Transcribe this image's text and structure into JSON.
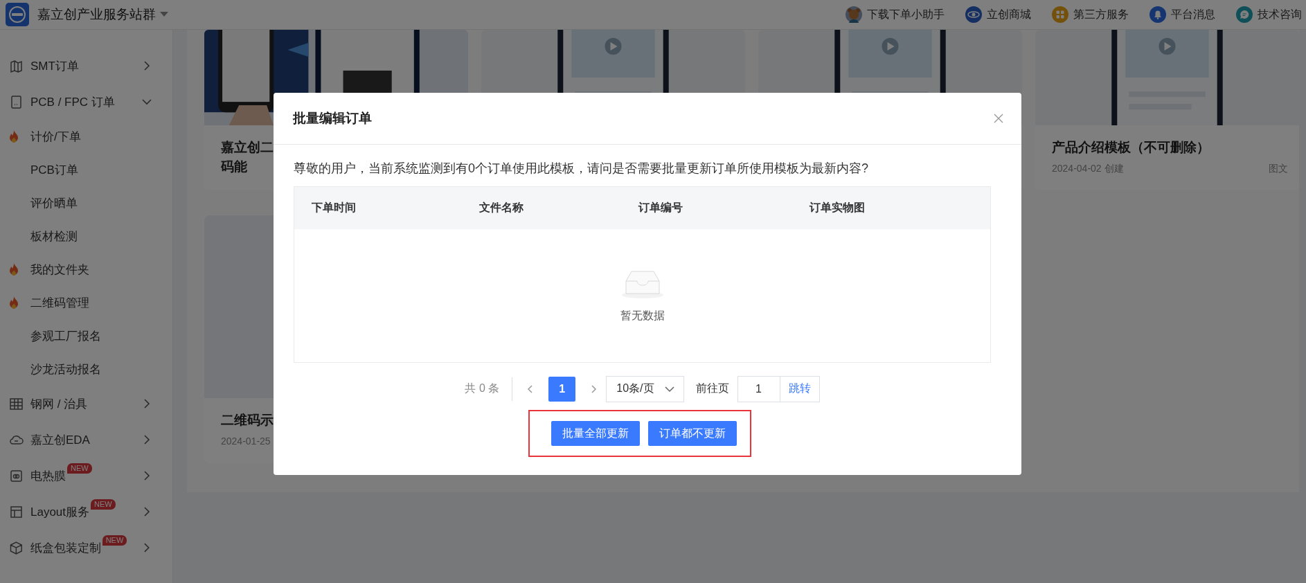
{
  "header": {
    "title": "嘉立创产业服务站群",
    "links": [
      {
        "label": "下载下单小助手",
        "kind": "bear"
      },
      {
        "label": "立创商城",
        "kind": "store"
      },
      {
        "label": "第三方服务",
        "kind": "apps"
      },
      {
        "label": "平台消息",
        "kind": "bell"
      },
      {
        "label": "技术咨询",
        "kind": "chat"
      }
    ]
  },
  "sidebar": {
    "items": [
      {
        "label": "SMT订单",
        "kind": "map",
        "expanded": false
      },
      {
        "label": "PCB / FPC 订单",
        "kind": "board",
        "expanded": true,
        "children": [
          {
            "label": "计价/下单",
            "hot": true
          },
          {
            "label": "PCB订单",
            "hot": false
          },
          {
            "label": "评价晒单",
            "hot": false
          },
          {
            "label": "板材检测",
            "hot": false
          },
          {
            "label": "我的文件夹",
            "hot": true
          },
          {
            "label": "二维码管理",
            "hot": true
          },
          {
            "label": "参观工厂报名",
            "hot": false
          },
          {
            "label": "沙龙活动报名",
            "hot": false
          }
        ]
      },
      {
        "label": "钢网 / 治具",
        "kind": "grid",
        "expanded": false
      },
      {
        "label": "嘉立创EDA",
        "kind": "cloud",
        "expanded": false
      },
      {
        "label": "电热膜",
        "kind": "film",
        "expanded": false,
        "badge": "NEW"
      },
      {
        "label": "Layout服务",
        "kind": "layout",
        "expanded": false,
        "badge": "NEW"
      },
      {
        "label": "纸盒包装定制",
        "kind": "box",
        "expanded": false,
        "badge": "NEW"
      }
    ]
  },
  "cards": [
    [
      {
        "kind": "picture",
        "title": [
          "嘉立创二",
          "码能"
        ]
      },
      {
        "kind": "picture"
      },
      {
        "kind": "picture"
      },
      {
        "kind": "picture",
        "title": [
          "产品介绍模板（不可删除）"
        ],
        "date": "2024-04-02 创建",
        "type": "图文"
      }
    ],
    [
      {
        "kind": "picture",
        "title": [
          "二维码示"
        ],
        "date": "2024-01-25"
      }
    ]
  ],
  "dialog": {
    "title": "批量编辑订单",
    "message": "尊敬的用户，当前系统监测到有0个订单使用此模板，请问是否需要批量更新订单所使用模板为最新内容?",
    "table": {
      "columns": [
        "下单时间",
        "文件名称",
        "订单编号",
        "订单实物图"
      ],
      "empty_text": "暂无数据"
    },
    "pagination": {
      "total": "共 0 条",
      "pages": [
        {
          "label": "1",
          "selected": true
        }
      ],
      "page_size": "10条/页",
      "goto_label": "前往页",
      "goto_value": "1",
      "goto_button": "跳转"
    },
    "buttons": [
      "批量全部更新",
      "订单都不更新"
    ]
  }
}
